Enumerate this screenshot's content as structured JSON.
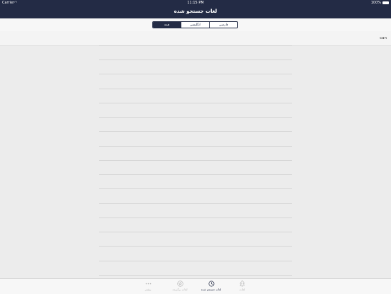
{
  "status_bar": {
    "carrier": "Carrier",
    "time": "11:15 PM",
    "battery": "100%"
  },
  "nav": {
    "title": "لغات جستجو شده"
  },
  "segments": {
    "items": [
      {
        "label": "فارسی",
        "active": false
      },
      {
        "label": "انگلیسی",
        "active": false
      },
      {
        "label": "همه",
        "active": true
      }
    ]
  },
  "list": {
    "header_word": "can"
  },
  "tabbar": {
    "items": [
      {
        "label": "لغات",
        "icon": "tree-icon",
        "active": false
      },
      {
        "label": "لغات جستجو شده",
        "icon": "history-icon",
        "active": true
      },
      {
        "label": "لغات برگزیده",
        "icon": "star-circle-icon",
        "active": false
      },
      {
        "label": "بیشتر",
        "icon": "more-dots-icon",
        "active": false
      }
    ]
  },
  "colors": {
    "brand": "#232b45",
    "background": "#ececec",
    "inactive": "#b0b0b0"
  }
}
